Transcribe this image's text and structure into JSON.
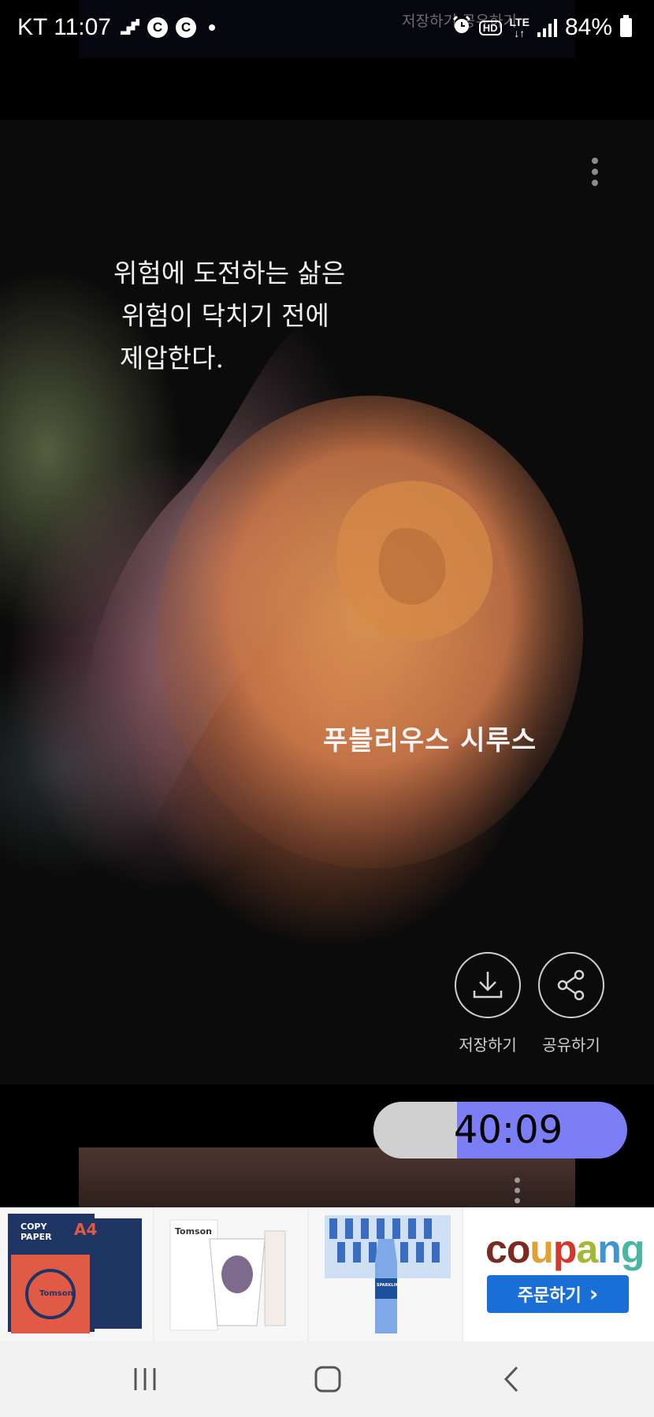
{
  "status_bar": {
    "carrier_time": "KT 11:07",
    "ghost_text": "저장하기   공유하기",
    "badge_c1": "C",
    "badge_c2": "C",
    "hd_label": "HD",
    "lte_label": "LTE",
    "battery": "84%"
  },
  "card": {
    "quote_lines": [
      "위험에 도전하는 삶은",
      "위험이 닥치기 전에",
      "제압한다."
    ],
    "author": "푸블리우스 시루스",
    "save_label": "저장하기",
    "share_label": "공유하기"
  },
  "timer": {
    "value": "40:09",
    "progress": 0.33
  },
  "ad": {
    "products": [
      {
        "name": "copy-paper",
        "label_a": "COPY PAPER",
        "label_b": "A4",
        "brand": "Tomson"
      },
      {
        "name": "paper-cups",
        "brand": "Tomson"
      },
      {
        "name": "sparkling-water",
        "brand": "SPARKLING"
      }
    ],
    "brand_letters": [
      "c",
      "o",
      "u",
      "p",
      "a",
      "n",
      "g"
    ],
    "brand_colors": [
      "#7b2a1f",
      "#7b2a1f",
      "#e2a033",
      "#d6372b",
      "#a3b835",
      "#3f94d2",
      "#49b5a3"
    ],
    "order_label": "주문하기",
    "order_arrow": "›"
  },
  "colors": {
    "timer_fill": "#7b7ef5",
    "timer_track": "#d0d0d0",
    "order_button": "#1a6fd6"
  }
}
